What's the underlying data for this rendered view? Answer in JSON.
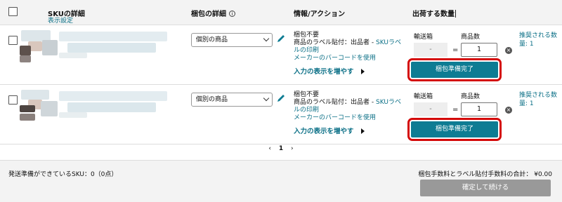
{
  "header": {
    "sku_details": "SKUの詳細",
    "display_settings": "表示設定",
    "packing_details": "梱包の詳細",
    "info_icon": "i",
    "info_action": "情報/アクション",
    "ship_qty": "出荷する数量"
  },
  "rows": [
    {
      "packing_select": "個別の商品",
      "info_line1": "梱包不要",
      "info_line2_prefix": "商品のラベル貼付：出品者 - ",
      "info_line2_link": "SKUラベルの印刷",
      "info_line3": "メーカーのバーコードを使用",
      "show_more": "入力の表示を増やす",
      "box_label": "輸送箱",
      "unit_label": "商品数",
      "box_value": "-",
      "equals": "=",
      "unit_value": "1",
      "pack_button": "梱包準備完了",
      "recommended": "推奨される数量: 1"
    },
    {
      "packing_select": "個別の商品",
      "info_line1": "梱包不要",
      "info_line2_prefix": "商品のラベル貼付：出品者 - ",
      "info_line2_link": "SKUラベルの印刷",
      "info_line3": "メーカーのバーコードを使用",
      "show_more": "入力の表示を増やす",
      "box_label": "輸送箱",
      "unit_label": "商品数",
      "box_value": "-",
      "equals": "=",
      "unit_value": "1",
      "pack_button": "梱包準備完了",
      "recommended": "推奨される数量: 1"
    }
  ],
  "pager": {
    "prev": "‹",
    "current": "1",
    "next": "›"
  },
  "footer": {
    "ready_sku": "発送準備ができているSKU：0（0点）",
    "fee_total": "梱包手数料とラベル貼付手数料の合計：  ¥0.00",
    "confirm_button": "確定して続ける"
  },
  "colors": {
    "accent": "#0e7c93",
    "highlight": "#d40a0a",
    "link": "#0a6f86"
  }
}
